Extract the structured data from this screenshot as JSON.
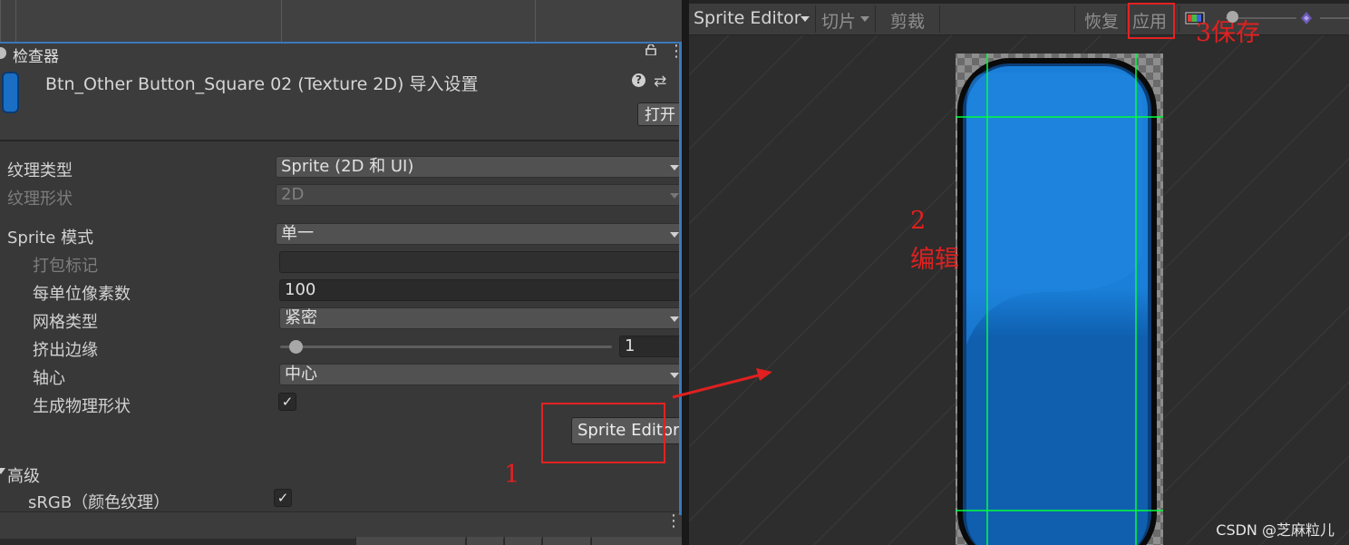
{
  "inspector": {
    "tab_title": "检查器",
    "asset_title": "Btn_Other Button_Square 02 (Texture 2D) 导入设置",
    "help_icon_glyph": "?",
    "open_button": "打开",
    "texture_type": {
      "label": "纹理类型",
      "value": "Sprite (2D 和 UI)"
    },
    "texture_shape": {
      "label": "纹理形状",
      "value": "2D"
    },
    "sprite_mode": {
      "label": "Sprite 模式",
      "value": "单一"
    },
    "packing_tag": {
      "label": "打包标记",
      "value": ""
    },
    "pixels_per_unit": {
      "label": "每单位像素数",
      "value": "100"
    },
    "mesh_type": {
      "label": "网格类型",
      "value": "紧密"
    },
    "extrude_edges": {
      "label": "挤出边缘",
      "value": "1",
      "slider_fraction": 0.05
    },
    "pivot": {
      "label": "轴心",
      "value": "中心"
    },
    "generate_physics": {
      "label": "生成物理形状",
      "checked": true
    },
    "sprite_editor_button": "Sprite Editor",
    "advanced_label": "高级",
    "srgb": {
      "label": "sRGB（颜色纹理）",
      "checked": true
    },
    "check_glyph": "✓",
    "kebab_glyph": "⋮"
  },
  "sprite_editor": {
    "mode_dropdown": "Sprite Editor",
    "slice_menu": "切片",
    "trim_button": "剪裁",
    "revert_button": "恢复",
    "apply_button": "应用"
  },
  "annotations": {
    "step1": "1",
    "step2_num": "2",
    "step2_text": "编辑",
    "step3": "3保存",
    "color": "#e02020"
  },
  "colors": {
    "sprite_blue": "#1a7fd8",
    "sprite_dark_blue": "#0f5fae",
    "border_line": "#00ff3c",
    "accent_blue": "#3a79bb"
  },
  "watermark": "CSDN @芝麻粒儿"
}
